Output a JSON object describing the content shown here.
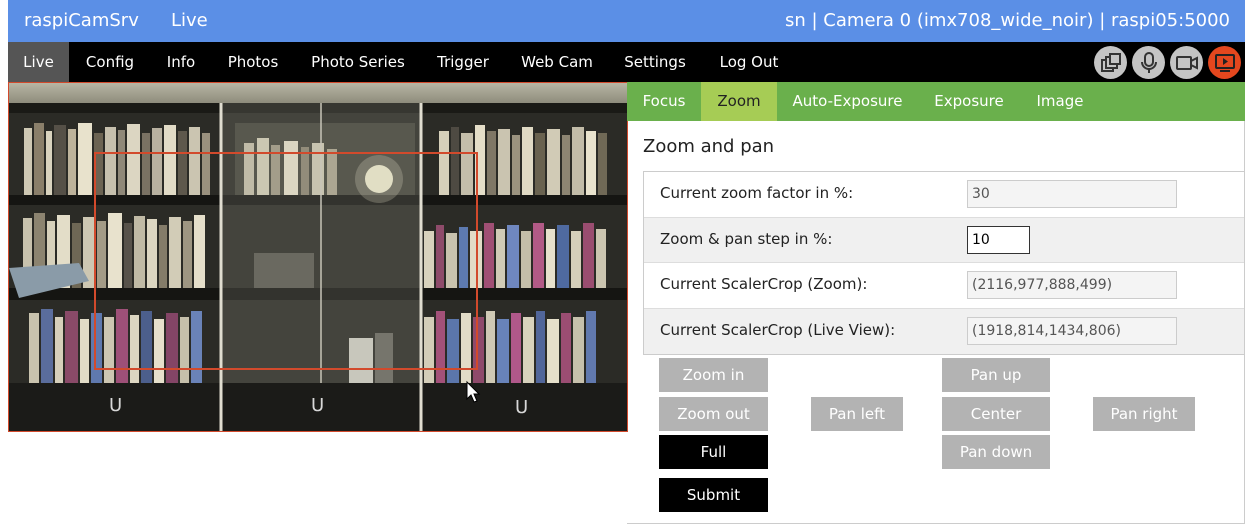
{
  "topbar": {
    "brand": "raspiCamSrv",
    "mode": "Live",
    "info": "sn | Camera 0 (imx708_wide_noir) | raspi05:5000"
  },
  "nav": {
    "items": [
      {
        "label": "Live",
        "active": true
      },
      {
        "label": "Config"
      },
      {
        "label": "Info"
      },
      {
        "label": "Photos"
      },
      {
        "label": "Photo Series"
      },
      {
        "label": "Trigger"
      },
      {
        "label": "Web Cam"
      },
      {
        "label": "Settings"
      },
      {
        "label": "Log Out"
      }
    ],
    "icons": [
      "switch-camera-icon",
      "microphone-icon",
      "video-camera-icon",
      "live-stream-icon"
    ]
  },
  "tabs": [
    {
      "label": "Focus"
    },
    {
      "label": "Zoom",
      "active": true
    },
    {
      "label": "Auto-Exposure"
    },
    {
      "label": "Exposure"
    },
    {
      "label": "Image"
    }
  ],
  "zoom": {
    "title": "Zoom and pan",
    "rows": [
      {
        "label": "Current zoom factor in %:",
        "value": "30"
      },
      {
        "label": "Zoom & pan step in %:",
        "value": "10"
      },
      {
        "label": "Current ScalerCrop (Zoom):",
        "value": "(2116,977,888,499)"
      },
      {
        "label": "Current ScalerCrop (Live View):",
        "value": "(1918,814,1434,806)"
      }
    ],
    "buttons": {
      "zoom_in": "Zoom in",
      "zoom_out": "Zoom out",
      "full": "Full",
      "submit": "Submit",
      "pan_up": "Pan up",
      "pan_left": "Pan left",
      "center": "Center",
      "pan_right": "Pan right",
      "pan_down": "Pan down"
    }
  },
  "colors": {
    "topbar": "#5b8fe6",
    "navbar": "#000000",
    "tabbar": "#6ab04c",
    "tab_active": "#a6cc55",
    "button": "#b3b3b3",
    "live_icon": "#e4471e",
    "crop_rect": "#d24a2c"
  }
}
